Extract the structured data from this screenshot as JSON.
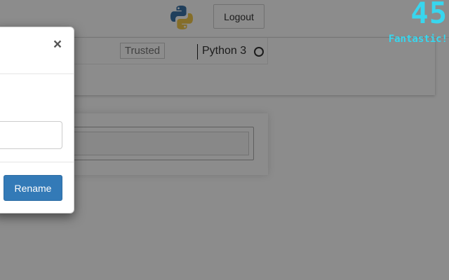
{
  "header": {
    "logo_icon": "python-logo-icon",
    "logout_label": "Logout"
  },
  "notebook": {
    "trusted_label": "Trusted",
    "kernel_name": "Python 3",
    "kernel_status_icon": "kernel-idle-circle-icon"
  },
  "dialog": {
    "close_label": "×",
    "name_value": "",
    "rename_label": "Rename",
    "rename_color": "#337ab7"
  },
  "overlay": {
    "score": "45",
    "caption": "Fantastic!",
    "color": "#38d6ee"
  }
}
